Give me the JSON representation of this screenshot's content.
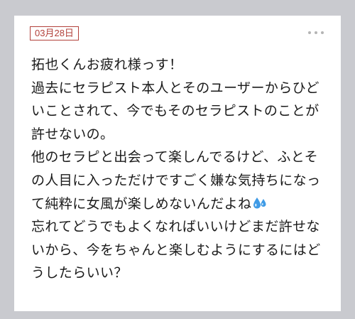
{
  "post": {
    "date": "03月28日",
    "lines": [
      "拓也くんお疲れ様っす！",
      "過去にセラピスト本人とそのユーザーからひど",
      "いことされて、今でもそのセラピストのことが",
      "許せないの。",
      "他のセラピと出会って楽しんでるけど、ふとそ",
      "の人目に入っただけですごく嫌な気持ちになっ",
      "て純粋に女風が楽しめないんだよね",
      "忘れてどうでもよくなればいいけどまだ許せな",
      "いから、今をちゃんと楽しむようにするにはど",
      "うしたらいい？"
    ],
    "emoji_icon": "sweat-droplets-icon"
  },
  "colors": {
    "background": "#c9cacf",
    "card": "#ffffff",
    "date_accent": "#b2403a",
    "text": "#1a1a1a",
    "menu_dots": "#b5b5b5",
    "emoji": "#3f9be6"
  }
}
